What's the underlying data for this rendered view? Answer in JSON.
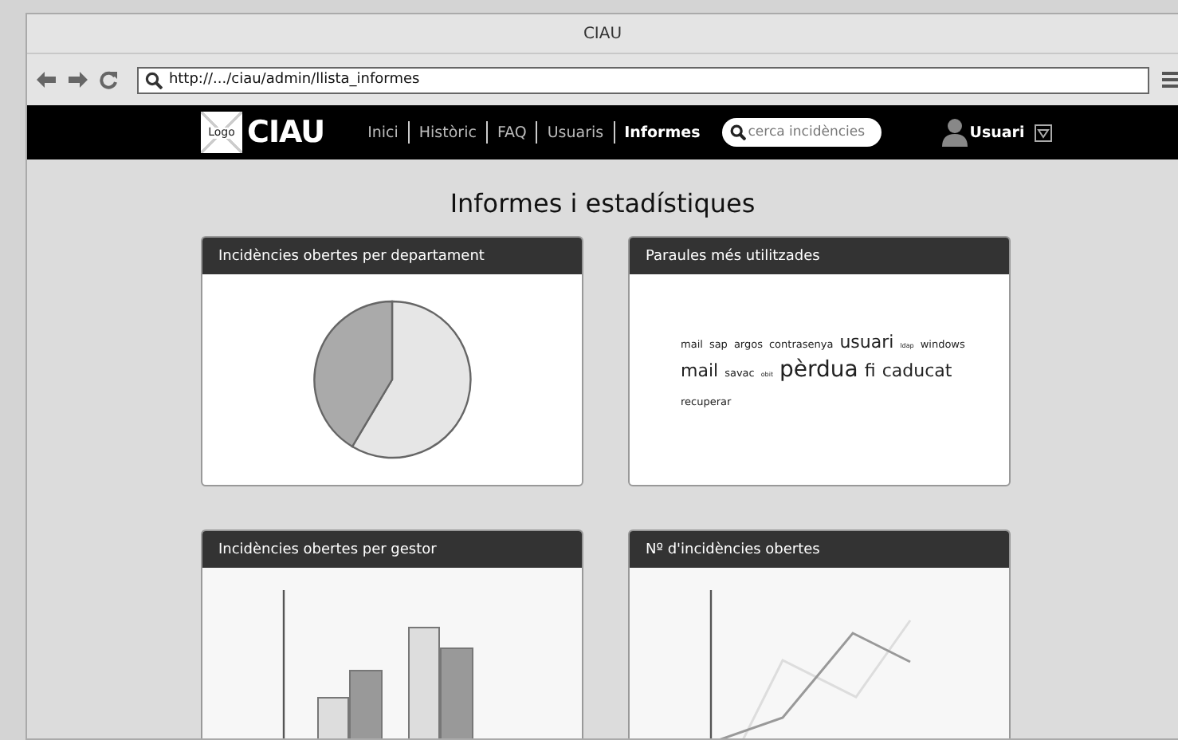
{
  "window": {
    "title": "CIAU"
  },
  "address_bar": {
    "url": "http://.../ciau/admin/llista_informes"
  },
  "navbar": {
    "logo_placeholder": "Logo",
    "brand": "CIAU",
    "links": [
      {
        "label": "Inici",
        "selected": false
      },
      {
        "label": "Històric",
        "selected": false
      },
      {
        "label": "FAQ",
        "selected": false
      },
      {
        "label": "Usuaris",
        "selected": false
      },
      {
        "label": "Informes",
        "selected": true
      }
    ],
    "search": {
      "placeholder": "cerca incidències"
    },
    "user": {
      "name": "Usuari"
    }
  },
  "page": {
    "heading": "Informes i estadístiques"
  },
  "cards": [
    {
      "kind": "pie",
      "title": "Incidències obertes per departament"
    },
    {
      "kind": "cloud",
      "title": "Paraules més utilitzades",
      "lines": [
        [
          {
            "text": "mail",
            "kind": "small"
          },
          {
            "text": "sap",
            "kind": "small"
          },
          {
            "text": "argos",
            "kind": "small"
          },
          {
            "text": "contrasenya",
            "kind": "small"
          },
          {
            "text": "usuari",
            "kind": "large"
          },
          {
            "text": "ldap",
            "kind": "tiny"
          },
          {
            "text": "windows",
            "kind": "small"
          }
        ],
        [
          {
            "text": "mail",
            "kind": "large"
          },
          {
            "text": "savac",
            "kind": "small"
          },
          {
            "text": "obit",
            "kind": "tiny"
          },
          {
            "text": "pèrdua",
            "kind": "huge"
          },
          {
            "text": "fi",
            "kind": "large"
          },
          {
            "text": "caducat",
            "kind": "large"
          }
        ],
        [
          {
            "text": "recuperar",
            "kind": "small"
          }
        ]
      ]
    },
    {
      "kind": "bar",
      "title": "Incidències obertes per gestor"
    },
    {
      "kind": "line",
      "title": "Nº d'incidències obertes"
    }
  ]
}
